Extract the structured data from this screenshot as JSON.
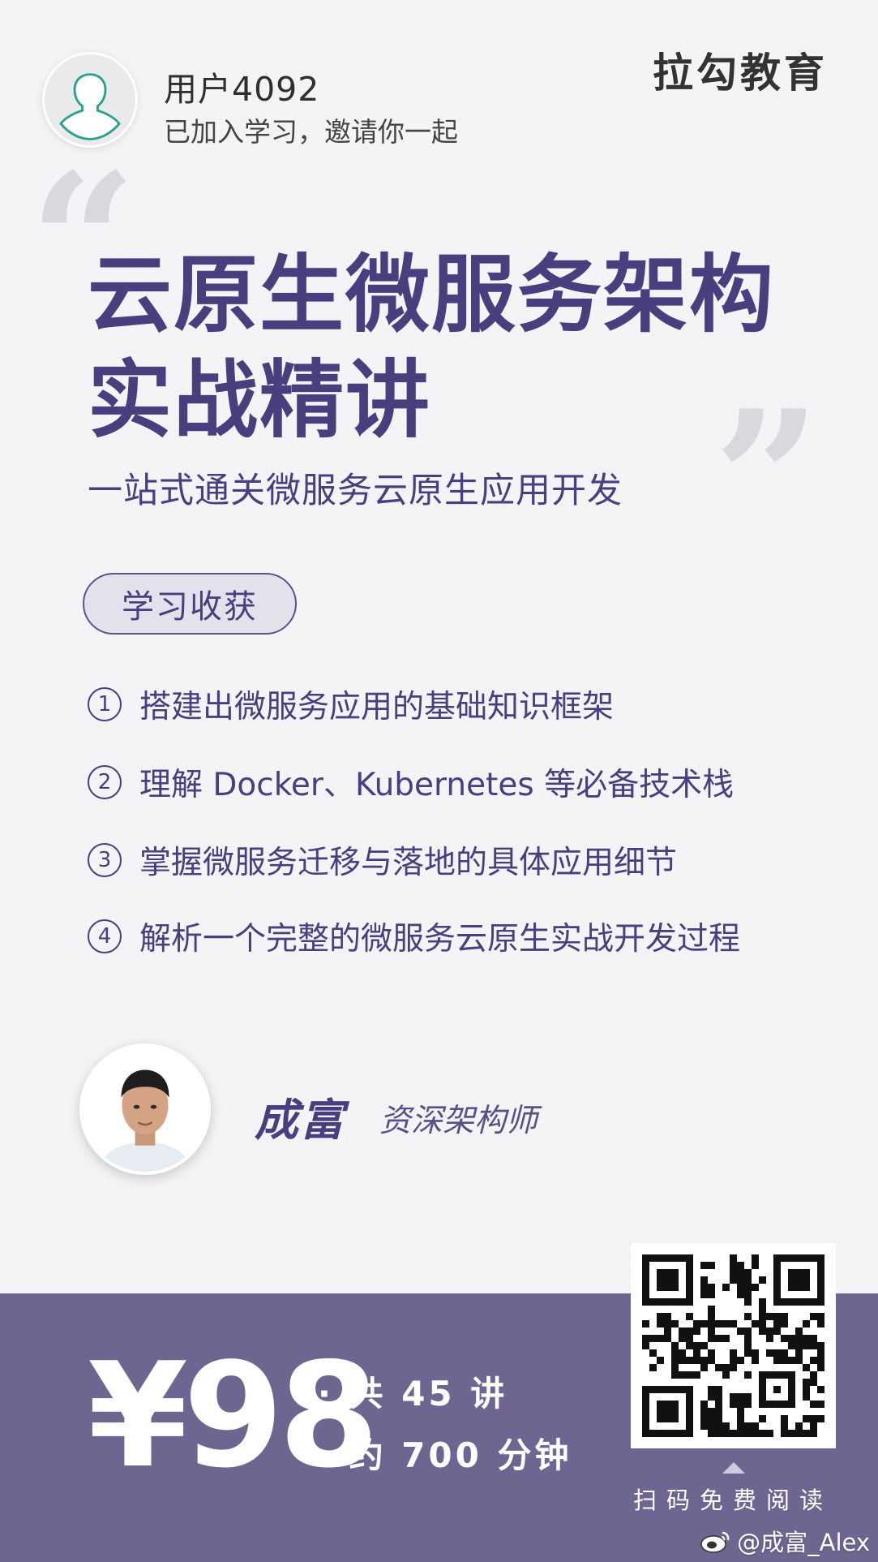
{
  "header": {
    "user_name": "用户4092",
    "user_status": "已加入学习，邀请你一起",
    "brand": "拉勾教育",
    "avatar_icon": "user-avatar-icon"
  },
  "course": {
    "title_line1": "云原生微服务架构",
    "title_line2": "实战精讲",
    "subtitle": "一站式通关微服务云原生应用开发",
    "quote_open": "“",
    "quote_close": "”"
  },
  "benefits": {
    "label": "学习收获",
    "items": [
      {
        "num": "1",
        "text": "搭建出微服务应用的基础知识框架"
      },
      {
        "num": "2",
        "text": "理解 Docker、Kubernetes 等必备技术栈"
      },
      {
        "num": "3",
        "text": "掌握微服务迁移与落地的具体应用细节"
      },
      {
        "num": "4",
        "text": "解析一个完整的微服务云原生实战开发过程"
      }
    ]
  },
  "instructor": {
    "name": "成富",
    "title": "资深架构师"
  },
  "pricing": {
    "price": "¥98",
    "lessons": "· 共 45 讲",
    "duration": "· 约 700 分钟"
  },
  "qr": {
    "caption": "扫码免费阅读"
  },
  "watermark": {
    "text": "@成富_Alex",
    "icon": "weibo-icon"
  },
  "colors": {
    "accent": "#4a3f7e",
    "band": "#6e6690",
    "background": "#f4f3f5"
  }
}
